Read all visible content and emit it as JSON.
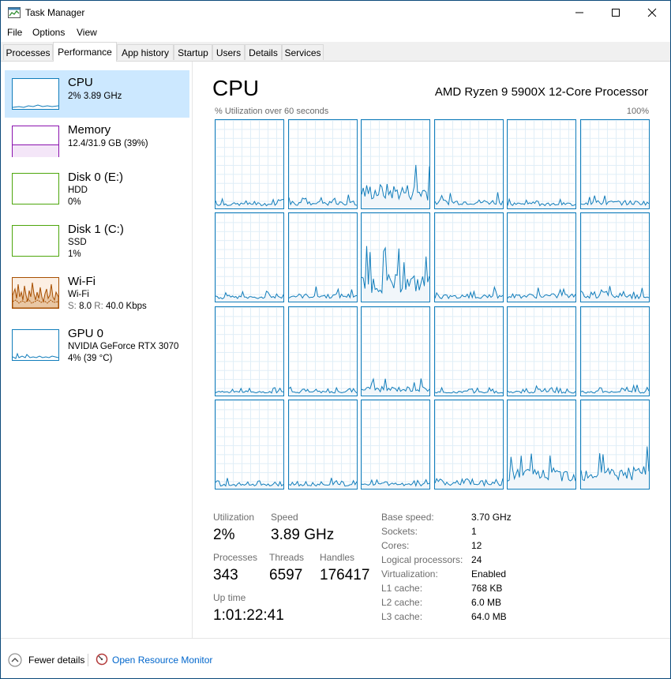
{
  "window": {
    "title": "Task Manager"
  },
  "menu": [
    "File",
    "Options",
    "View"
  ],
  "tabs": [
    "Processes",
    "Performance",
    "App history",
    "Startup",
    "Users",
    "Details",
    "Services"
  ],
  "active_tab": "Performance",
  "sidebar": [
    {
      "title": "CPU",
      "line1": "2% 3.89 GHz",
      "line2": "",
      "selected": true
    },
    {
      "title": "Memory",
      "line1": "12.4/31.9 GB (39%)",
      "line2": ""
    },
    {
      "title": "Disk 0 (E:)",
      "line1": "HDD",
      "line2": "0%"
    },
    {
      "title": "Disk 1 (C:)",
      "line1": "SSD",
      "line2": "1%"
    },
    {
      "title": "Wi-Fi",
      "line1": "Wi-Fi",
      "line2_s_label": "S:",
      "line2_s": "8.0",
      "line2_r_label": "R:",
      "line2_r": "40.0 Kbps"
    },
    {
      "title": "GPU 0",
      "line1": "NVIDIA GeForce RTX 3070",
      "line2": "4% (39 °C)"
    }
  ],
  "main": {
    "title": "CPU",
    "model": "AMD Ryzen 9 5900X 12-Core Processor",
    "axis_label": "% Utilization over 60 seconds",
    "axis_max": "100%"
  },
  "stats": {
    "utilization_label": "Utilization",
    "utilization": "2%",
    "speed_label": "Speed",
    "speed": "3.89 GHz",
    "processes_label": "Processes",
    "processes": "343",
    "threads_label": "Threads",
    "threads": "6597",
    "handles_label": "Handles",
    "handles": "176417",
    "uptime_label": "Up time",
    "uptime": "1:01:22:41"
  },
  "details": [
    {
      "label": "Base speed:",
      "value": "3.70 GHz"
    },
    {
      "label": "Sockets:",
      "value": "1"
    },
    {
      "label": "Cores:",
      "value": "12"
    },
    {
      "label": "Logical processors:",
      "value": "24"
    },
    {
      "label": "Virtualization:",
      "value": "Enabled"
    },
    {
      "label": "L1 cache:",
      "value": "768 KB"
    },
    {
      "label": "L2 cache:",
      "value": "6.0 MB"
    },
    {
      "label": "L3 cache:",
      "value": "64.0 MB"
    }
  ],
  "footer": {
    "fewer_details": "Fewer details",
    "open_resource_monitor": "Open Resource Monitor"
  },
  "colors": {
    "cpu": "#117dbb",
    "memory": "#8b12ae",
    "disk": "#4da60c",
    "wifi": "#a74f01",
    "selected_bg": "#cce8ff"
  },
  "core_activity": [
    0.04,
    0.05,
    0.22,
    0.07,
    0.04,
    0.06,
    0.04,
    0.06,
    0.24,
    0.05,
    0.06,
    0.05,
    0.03,
    0.03,
    0.07,
    0.03,
    0.03,
    0.03,
    0.03,
    0.03,
    0.04,
    0.05,
    0.18,
    0.2
  ]
}
